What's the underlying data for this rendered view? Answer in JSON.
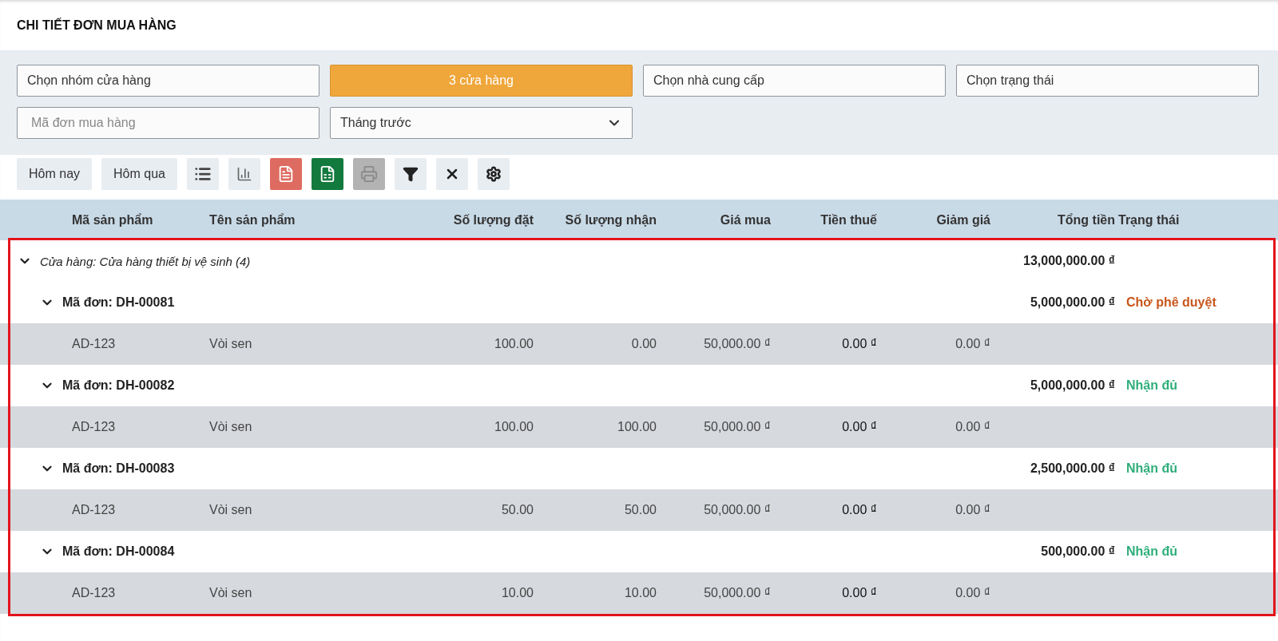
{
  "title": "CHI TIẾT ĐƠN MUA HÀNG",
  "filters": [
    {
      "kind": "select",
      "text": "Chọn nhóm cửa hàng"
    },
    {
      "kind": "button",
      "text": "3 cửa hàng"
    },
    {
      "kind": "select",
      "text": "Chọn nhà cung cấp"
    },
    {
      "kind": "select",
      "text": "Chọn trạng thái"
    },
    {
      "kind": "input",
      "placeholder": "Mã đơn mua hàng"
    },
    {
      "kind": "dropdown",
      "text": "Tháng trước"
    }
  ],
  "toolbar": [
    {
      "kind": "text",
      "label": "Hôm nay"
    },
    {
      "kind": "text",
      "label": "Hôm qua"
    },
    {
      "kind": "list",
      "disabled": false
    },
    {
      "kind": "chart",
      "disabled": false
    },
    {
      "kind": "pdf",
      "disabled": false
    },
    {
      "kind": "excel",
      "disabled": false
    },
    {
      "kind": "print",
      "disabled": true
    },
    {
      "kind": "filter",
      "disabled": false
    },
    {
      "kind": "clear",
      "disabled": false
    },
    {
      "kind": "settings",
      "disabled": false
    }
  ],
  "table": {
    "columns": [
      "Mã sản phẩm",
      "Tên sản phẩm",
      "Số lượng đặt",
      "Số lượng nhận",
      "Giá mua",
      "Tiền thuế",
      "Giảm giá",
      "Tổng tiền",
      "Trạng thái"
    ],
    "groups": [
      {
        "label": "Cửa hàng: Cửa hàng thiết bị vệ sinh (4)",
        "total": "13,000,000.00 ₫",
        "expanded": true,
        "orders": [
          {
            "label": "Mã đơn: DH-00081",
            "total": "5,000,000.00 ₫",
            "status": "Chờ phê duyệt",
            "color": "#c8561c",
            "expanded": true,
            "items": [
              {
                "code": "AD-123",
                "name": "Vòi sen",
                "ordered": "100.00",
                "received": "0.00",
                "price": "50,000.00 ₫",
                "tax": "0.00 ₫",
                "discount": "0.00 ₫"
              }
            ]
          },
          {
            "label": "Mã đơn: DH-00082",
            "total": "5,000,000.00 ₫",
            "status": "Nhận đủ",
            "color": "#2fae7a",
            "expanded": true,
            "items": [
              {
                "code": "AD-123",
                "name": "Vòi sen",
                "ordered": "100.00",
                "received": "100.00",
                "price": "50,000.00 ₫",
                "tax": "0.00 ₫",
                "discount": "0.00 ₫"
              }
            ]
          },
          {
            "label": "Mã đơn: DH-00083",
            "total": "2,500,000.00 ₫",
            "status": "Nhận đủ",
            "color": "#2fae7a",
            "expanded": true,
            "items": [
              {
                "code": "AD-123",
                "name": "Vòi sen",
                "ordered": "50.00",
                "received": "50.00",
                "price": "50,000.00 ₫",
                "tax": "0.00 ₫",
                "discount": "0.00 ₫"
              }
            ]
          },
          {
            "label": "Mã đơn: DH-00084",
            "total": "500,000.00 ₫",
            "status": "Nhận đủ",
            "color": "#2fae7a",
            "expanded": true,
            "items": [
              {
                "code": "AD-123",
                "name": "Vòi sen",
                "ordered": "10.00",
                "received": "10.00",
                "price": "50,000.00 ₫",
                "tax": "0.00 ₫",
                "discount": "0.00 ₫"
              }
            ]
          }
        ]
      }
    ]
  }
}
